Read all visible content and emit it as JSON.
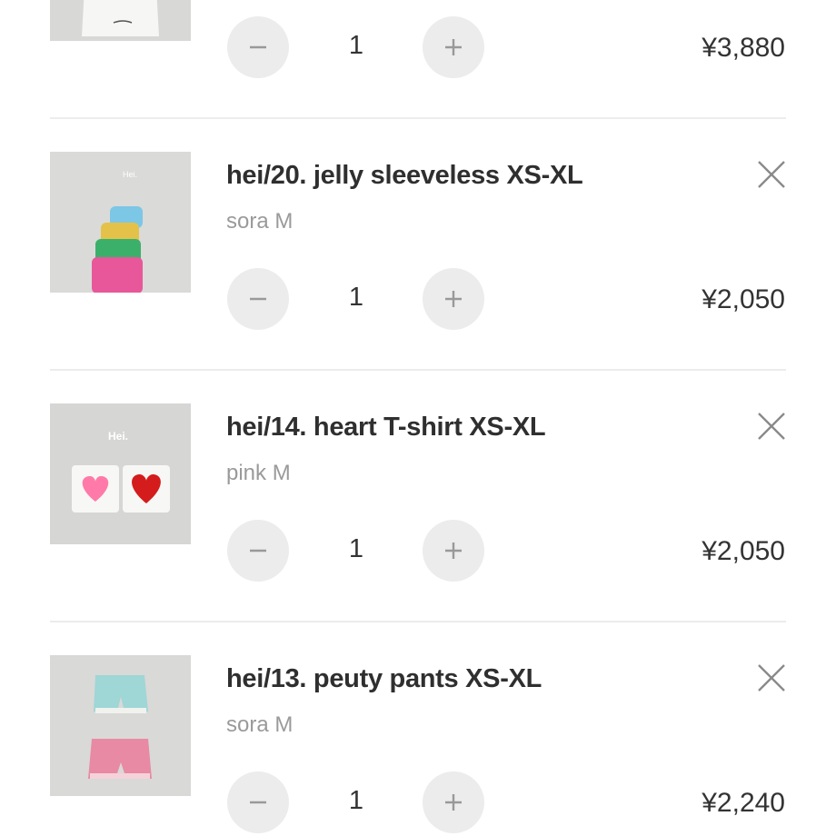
{
  "cart": {
    "items": [
      {
        "title": "",
        "variant": "",
        "quantity": "1",
        "price": "¥3,880",
        "thumbnail_icon": "white-top-product-photo"
      },
      {
        "title": "hei/20. jelly sleeveless XS-XL",
        "variant": "sora M",
        "quantity": "1",
        "price": "¥2,050",
        "thumbnail_icon": "sleeveless-tops-product-photo",
        "thumbnail_text": "Hei."
      },
      {
        "title": "hei/14. heart T-shirt XS-XL",
        "variant": "pink M",
        "quantity": "1",
        "price": "¥2,050",
        "thumbnail_icon": "heart-tshirt-product-photo",
        "thumbnail_text": "Hei."
      },
      {
        "title": "hei/13. peuty pants XS-XL",
        "variant": "sora M",
        "quantity": "1",
        "price": "¥2,240",
        "thumbnail_icon": "shorts-product-photo"
      }
    ]
  },
  "icons": {
    "decrease": "minus-icon",
    "increase": "plus-icon",
    "remove": "close-icon"
  },
  "colors": {
    "stepper_bg": "#ececec",
    "divider": "#ececec",
    "title": "#2f2f2f",
    "variant": "#9a9a9a"
  }
}
